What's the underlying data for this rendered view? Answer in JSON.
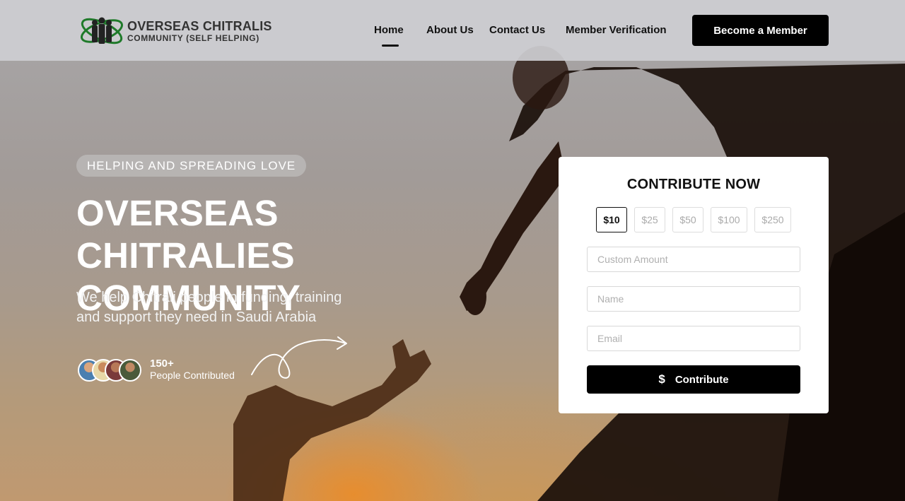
{
  "brand": {
    "name_line1": "OVERSEAS CHITRALIS",
    "name_line2": "COMMUNITY (SELF HELPING)",
    "logo_icon": "people-globe-icon"
  },
  "nav": {
    "items": [
      {
        "label": "Home",
        "active": true
      },
      {
        "label": "About Us",
        "active": false
      },
      {
        "label": "Contact Us",
        "active": false
      },
      {
        "label": "Member Verification",
        "active": false
      }
    ],
    "cta_label": "Become a Member"
  },
  "hero": {
    "tagline": "HELPING AND SPREADING LOVE",
    "title_line1": "OVERSEAS CHITRALIES",
    "title_line2": "COMMUNITY",
    "subtitle_line1": "We help Chitrali people in funding, training",
    "subtitle_line2": "and support they need in Saudi Arabia",
    "contributors_count": "150+",
    "contributors_label": "People Contributed"
  },
  "donation": {
    "title": "CONTRIBUTE NOW",
    "amounts": [
      "$10",
      "$25",
      "$50",
      "$100",
      "$250"
    ],
    "selected_amount": "$10",
    "custom_amount_placeholder": "Custom Amount",
    "name_placeholder": "Name",
    "email_placeholder": "Email",
    "submit_label": "Contribute",
    "submit_icon": "dollar-icon"
  },
  "colors": {
    "primary": "#000000",
    "header_bg": "#cecece",
    "logo_green": "#1f7a2a"
  }
}
